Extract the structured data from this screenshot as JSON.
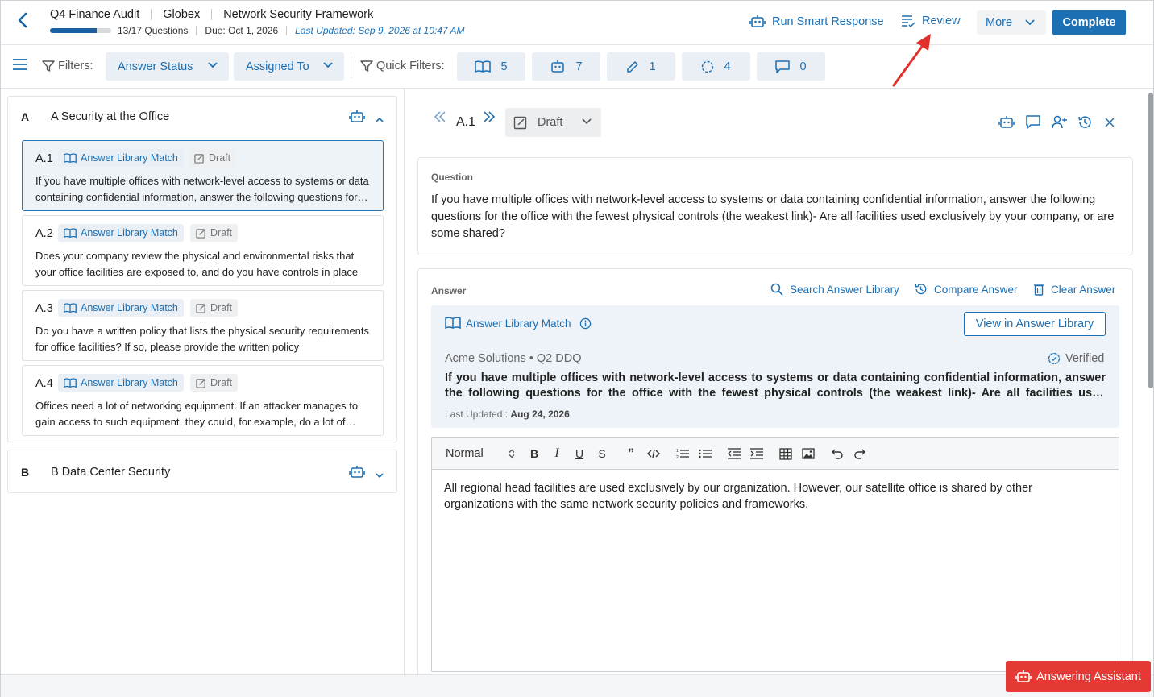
{
  "header": {
    "project": "Q4 Finance Audit",
    "client": "Globex",
    "framework": "Network Security Framework",
    "progress_text": "13/17 Questions",
    "progress_fraction": 0.76,
    "due": "Due: Oct 1, 2026",
    "last_updated": "Last Updated: Sep 9, 2026 at 10:47 AM",
    "run_smart_response": "Run Smart Response",
    "review": "Review",
    "more": "More",
    "complete": "Complete"
  },
  "filters": {
    "label": "Filters:",
    "answer_status": "Answer Status",
    "assigned_to": "Assigned To",
    "quick_label": "Quick Filters:",
    "quick": [
      {
        "icon": "book-icon",
        "count": "5"
      },
      {
        "icon": "robot-icon",
        "count": "7"
      },
      {
        "icon": "pencil-icon",
        "count": "1"
      },
      {
        "icon": "dashed-circle-icon",
        "count": "4"
      },
      {
        "icon": "comment-icon",
        "count": "0"
      }
    ]
  },
  "sections": [
    {
      "letter": "A",
      "title": "A Security at the Office",
      "questions": [
        {
          "id": "A.1",
          "tag": "Answer Library Match",
          "status": "Draft",
          "text": "If you have multiple offices with network-level access to systems or data containing confidential information, answer the following questions for the office with the fewest physical controls"
        },
        {
          "id": "A.2",
          "tag": "Answer Library Match",
          "status": "Draft",
          "text": "Does your company review the physical and environmental risks that your office facilities are exposed to, and do you have controls in place"
        },
        {
          "id": "A.3",
          "tag": "Answer Library Match",
          "status": "Draft",
          "text": "Do you have a written policy that lists the physical security requirements for office facilities? If so, please provide the written policy"
        },
        {
          "id": "A.4",
          "tag": "Answer Library Match",
          "status": "Draft",
          "text": "Offices need a lot of networking equipment. If an attacker manages to gain access to such equipment, they could, for example, do a lot of damage"
        }
      ]
    },
    {
      "letter": "B",
      "title": "B Data Center Security"
    }
  ],
  "detail": {
    "id": "A.1",
    "status": "Draft",
    "question_label": "Question",
    "question": "If you have multiple offices with network-level access to systems or data containing confidential information, answer the following questions for the office with the fewest physical controls (the weakest link)- Are all facilities used exclusively by your company, or are some shared?",
    "answer_label": "Answer",
    "search_library": "Search Answer Library",
    "compare": "Compare Answer",
    "clear": "Clear Answer",
    "library_match": "Answer Library Match",
    "view_library": "View in Answer Library",
    "source": "Acme Solutions • Q2 DDQ",
    "verified": "Verified",
    "library_text": "If you have multiple offices with network-level access to systems or data containing confidential information, answer the following questions for the office with the fewest physical controls (the weakest link)- Are all facilities used exclusively by your company, or are some shared?",
    "last_updated_label": "Last Updated :",
    "last_updated_value": "Aug 24, 2026",
    "format": "Normal",
    "answer_text": "All regional head facilities are used exclusively by our organization. However, our satellite office is shared by other organizations with the same network security policies and frameworks."
  },
  "assistant": "Answering Assistant",
  "colors": {
    "accent": "#1c6fb3",
    "assistant": "#e53935",
    "arrow": "#e0302a"
  }
}
